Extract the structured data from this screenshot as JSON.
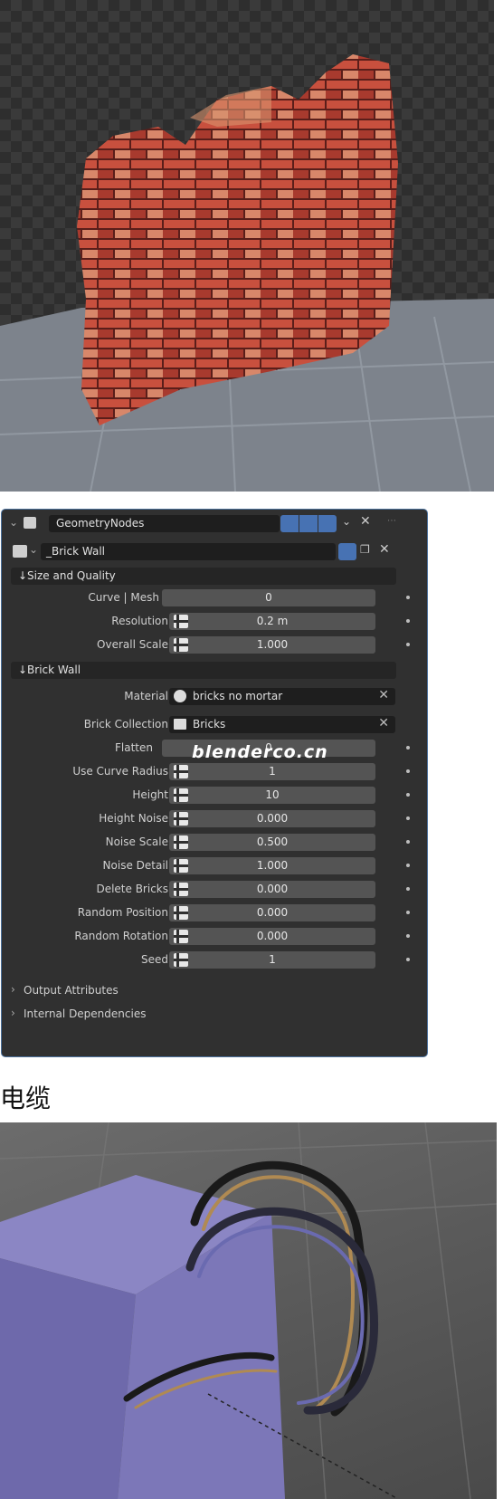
{
  "modifier": {
    "name": "GeometryNodes",
    "node_group": "_Brick Wall"
  },
  "sections": {
    "size_quality": "↓Size and Quality",
    "brick_wall": "↓Brick Wall"
  },
  "size_quality_params": [
    {
      "label": "Curve | Mesh",
      "value": "0"
    },
    {
      "label": "Resolution",
      "value": "0.2 m"
    },
    {
      "label": "Overall Scale",
      "value": "1.000"
    }
  ],
  "material": {
    "label": "Material",
    "value": "bricks no mortar"
  },
  "brick_collection": {
    "label": "Brick Collection",
    "value": "Bricks"
  },
  "flatten": {
    "label": "Flatten",
    "value": "0"
  },
  "brick_params": [
    {
      "label": "Use Curve Radius",
      "value": "1"
    },
    {
      "label": "Height",
      "value": "10"
    },
    {
      "label": "Height Noise",
      "value": "0.000"
    },
    {
      "label": "Noise Scale",
      "value": "0.500"
    },
    {
      "label": "Noise Detail",
      "value": "1.000"
    },
    {
      "label": "Delete Bricks",
      "value": "0.000"
    },
    {
      "label": "Random Position",
      "value": "0.000"
    },
    {
      "label": "Random Rotation",
      "value": "0.000"
    },
    {
      "label": "Seed",
      "value": "1"
    }
  ],
  "subpanels": {
    "output_attributes": "Output Attributes",
    "internal_dependencies": "Internal Dependencies"
  },
  "heading": "电缆",
  "watermark": "blenderco.cn",
  "colors": {
    "panel_bg": "#303030",
    "field_bg": "#545454",
    "accent_blue": "#4772b3",
    "outline": "#4a6f9a"
  }
}
